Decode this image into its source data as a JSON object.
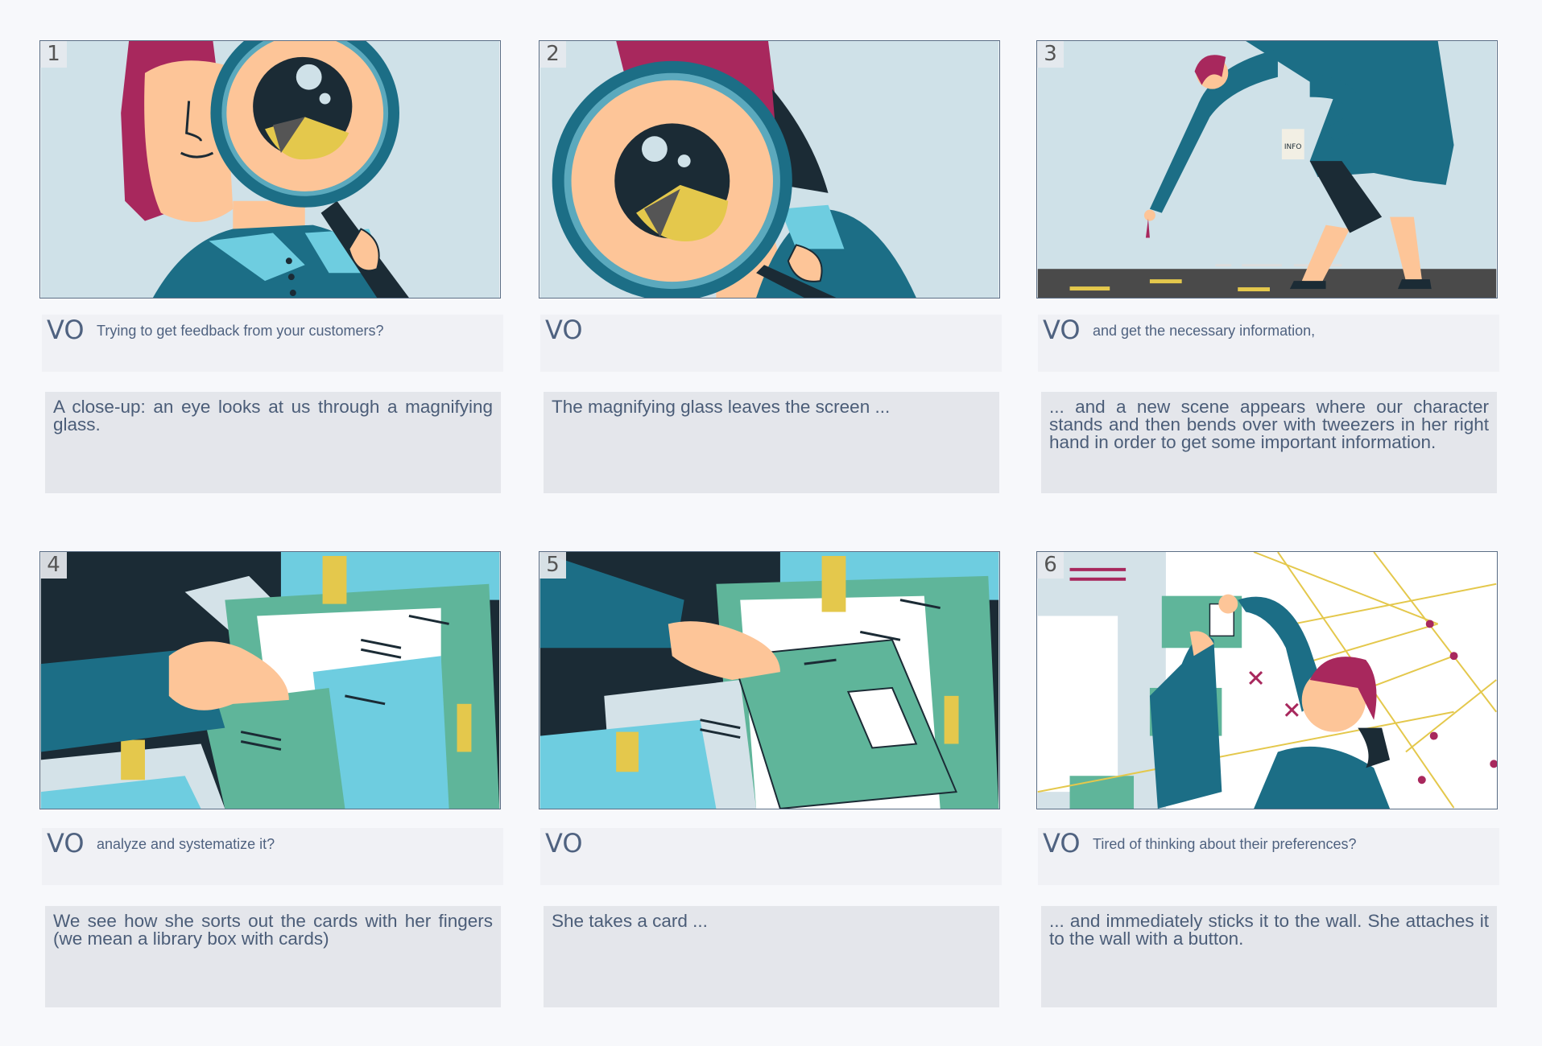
{
  "panels": [
    {
      "number": "1",
      "vo_tag": "VO",
      "vo": "Trying to get feedback from your customers?",
      "description": "A close-up: an eye looks at us through a magnifying glass."
    },
    {
      "number": "2",
      "vo_tag": "VO",
      "vo": "",
      "description": "The magnifying glass leaves the screen ..."
    },
    {
      "number": "3",
      "vo_tag": "VO",
      "vo": "and get the necessary information,",
      "description": "... and a new scene appears where our character stands and then bends over with tweezers in her right hand in order to get some important information."
    },
    {
      "number": "4",
      "vo_tag": "VO",
      "vo": "analyze and systematize it?",
      "description": "We see how she sorts out the cards with her fingers (we mean a library box with cards)"
    },
    {
      "number": "5",
      "vo_tag": "VO",
      "vo": "",
      "description": "She takes a card ..."
    },
    {
      "number": "6",
      "vo_tag": "VO",
      "vo": "Tired of thinking about their preferences?",
      "description": "... and immediately sticks it to the wall. She attaches it to the wall with a button."
    }
  ],
  "illustrations": {
    "panel3_cup_label": "INFO"
  },
  "colors": {
    "sky": "#cfe1e8",
    "skin": "#fdc598",
    "teal": "#1c6e86",
    "hair": "#a8285d",
    "light_blue": "#6ecde0",
    "dark": "#1b2b35",
    "yellow": "#e4c84c",
    "green": "#5fb59a"
  }
}
